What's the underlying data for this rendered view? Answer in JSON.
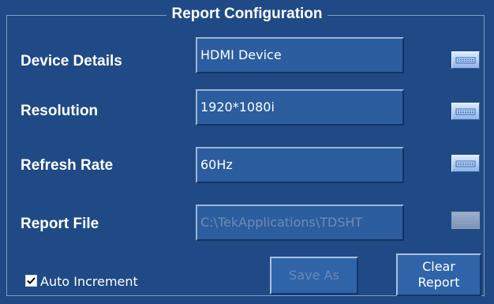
{
  "title": "Report Configuration",
  "fields": [
    {
      "label": "Device Details",
      "value": "HDMI Device",
      "enabled": true,
      "keyboard_icon": "keyboard-icon"
    },
    {
      "label": "Resolution",
      "value": "1920*1080i",
      "enabled": true,
      "keyboard_icon": "keyboard-icon"
    },
    {
      "label": "Refresh Rate",
      "value": "60Hz",
      "enabled": true,
      "keyboard_icon": "keyboard-icon"
    },
    {
      "label": "Report File",
      "value": "C:\\TekApplications\\TDSHT",
      "enabled": false,
      "keyboard_icon": "keyboard-icon"
    }
  ],
  "auto_increment": {
    "label": "Auto Increment",
    "checked": true
  },
  "buttons": {
    "save_as": {
      "label": "Save As",
      "enabled": false
    },
    "clear_report": {
      "line1": "Clear",
      "line2": "Report",
      "enabled": true
    }
  },
  "colors": {
    "background": "#1f4a85",
    "field": "#2b5d9f",
    "text": "#ffffff",
    "disabled_text": "#6f8ab4"
  }
}
